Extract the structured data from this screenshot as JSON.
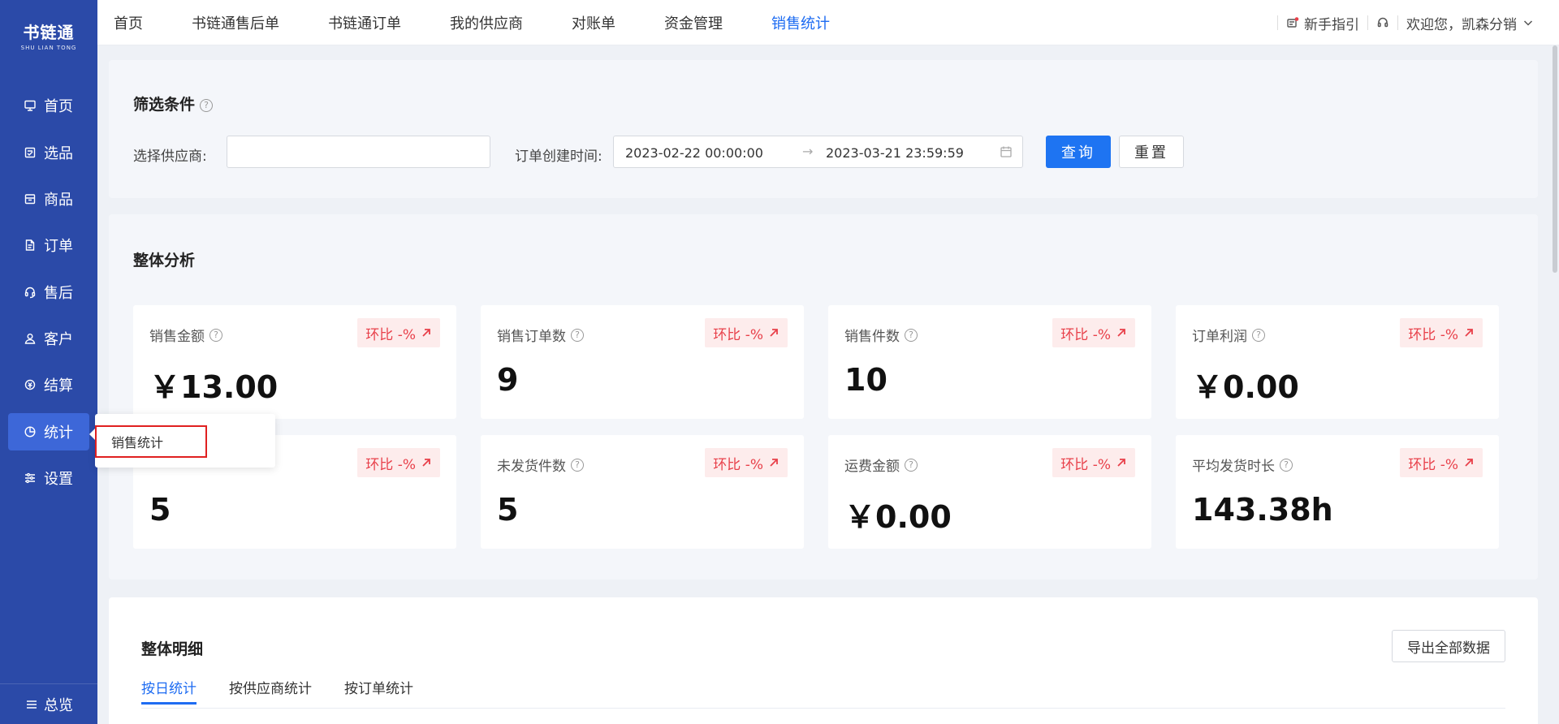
{
  "app": {
    "logo_main": "书链通",
    "logo_sub": "SHU LIAN TONG"
  },
  "sidebar": {
    "items": [
      {
        "label": "首页",
        "icon": "monitor-icon"
      },
      {
        "label": "选品",
        "icon": "select-product-icon"
      },
      {
        "label": "商品",
        "icon": "goods-box-icon"
      },
      {
        "label": "订单",
        "icon": "order-doc-icon"
      },
      {
        "label": "售后",
        "icon": "headset-icon"
      },
      {
        "label": "客户",
        "icon": "customer-icon"
      },
      {
        "label": "结算",
        "icon": "settle-icon"
      },
      {
        "label": "统计",
        "icon": "pie-chart-icon"
      },
      {
        "label": "设置",
        "icon": "sliders-icon"
      }
    ],
    "active": "统计",
    "overview_label": "总览"
  },
  "topnav": {
    "items": [
      "首页",
      "书链通售后单",
      "书链通订单",
      "我的供应商",
      "对账单",
      "资金管理",
      "销售统计"
    ],
    "active": "销售统计",
    "guide_label": "新手指引",
    "welcome_label": "欢迎您，凯森分销"
  },
  "filter": {
    "title": "筛选条件",
    "supplier_label": "选择供应商:",
    "supplier_value": "",
    "time_label": "订单创建时间:",
    "start_time": "2023-02-22 00:00:00",
    "end_time": "2023-03-21 23:59:59",
    "query_label": "查询",
    "reset_label": "重置"
  },
  "overall": {
    "title": "整体分析",
    "cards": [
      {
        "label": "销售金额",
        "badge": "环比 -%",
        "value": "￥13.00"
      },
      {
        "label": "销售订单数",
        "badge": "环比 -%",
        "value": "9"
      },
      {
        "label": "销售件数",
        "badge": "环比 -%",
        "value": "10"
      },
      {
        "label": "订单利润",
        "badge": "环比 -%",
        "value": "￥0.00"
      },
      {
        "label": "",
        "badge": "环比 -%",
        "value": "5"
      },
      {
        "label": "未发货件数",
        "badge": "环比 -%",
        "value": "5"
      },
      {
        "label": "运费金额",
        "badge": "环比 -%",
        "value": "￥0.00"
      },
      {
        "label": "平均发货时长",
        "badge": "环比 -%",
        "value": "143.38h"
      }
    ]
  },
  "popover": {
    "item_label": "销售统计"
  },
  "detail": {
    "title": "整体明细",
    "export_label": "导出全部数据",
    "tabs": [
      "按日统计",
      "按供应商统计",
      "按订单统计"
    ],
    "active_tab": "按日统计"
  },
  "colors": {
    "sidebar_bg": "#2b4aa8",
    "accent": "#1e6cf2",
    "badge_red": "#e8404a"
  }
}
